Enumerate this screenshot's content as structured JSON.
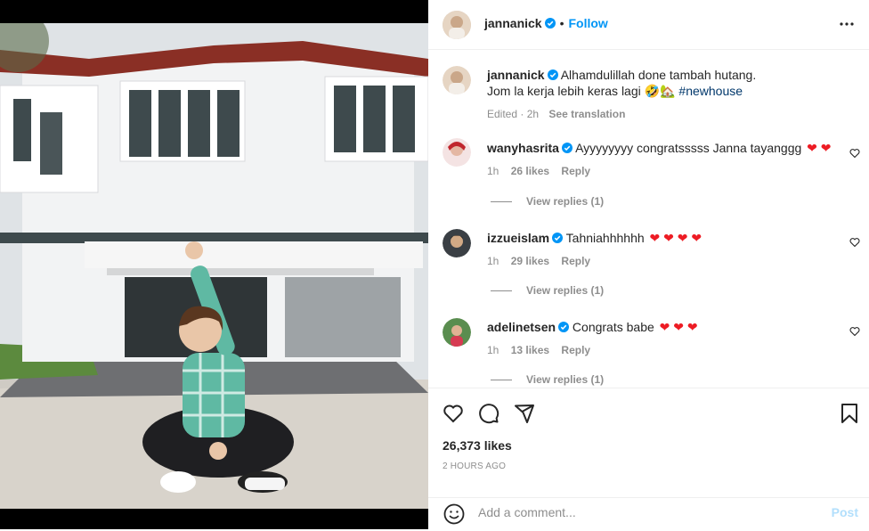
{
  "post": {
    "author": "jannanick",
    "follow_label": "Follow",
    "caption_line1": "Alhamdulillah done tambah hutang.",
    "caption_line2": "Jom la kerja lebih keras lagi",
    "caption_emojis": "🤣🏡",
    "hashtag": "#newhouse",
    "edited": "Edited · 2h",
    "see_translation": "See translation",
    "likes": "26,373 likes",
    "time_ago": "2 HOURS AGO"
  },
  "comments": [
    {
      "user": "wanyhasrita",
      "text": "Ayyyyyyyy congratsssss Janna tayanggg",
      "hearts": "❤ ❤",
      "time": "1h",
      "likes": "26 likes",
      "reply": "Reply",
      "view_replies": "View replies (1)"
    },
    {
      "user": "izzueislam",
      "text": "Tahniahhhhhh",
      "hearts": "❤ ❤ ❤ ❤",
      "time": "1h",
      "likes": "29 likes",
      "reply": "Reply",
      "view_replies": "View replies (1)"
    },
    {
      "user": "adelinetsen",
      "text": "Congrats babe",
      "hearts": "❤ ❤ ❤",
      "time": "1h",
      "likes": "13 likes",
      "reply": "Reply",
      "view_replies": "View replies (1)"
    }
  ],
  "add_comment": {
    "placeholder": "Add a comment...",
    "post_label": "Post"
  },
  "icons": [
    "verified-badge-icon",
    "more-options-icon",
    "heart-icon",
    "comment-icon",
    "share-icon",
    "bookmark-icon",
    "emoji-icon"
  ],
  "colors": {
    "accent": "#0095f6",
    "verified": "#0095f6",
    "heart": "#ed1c24"
  }
}
